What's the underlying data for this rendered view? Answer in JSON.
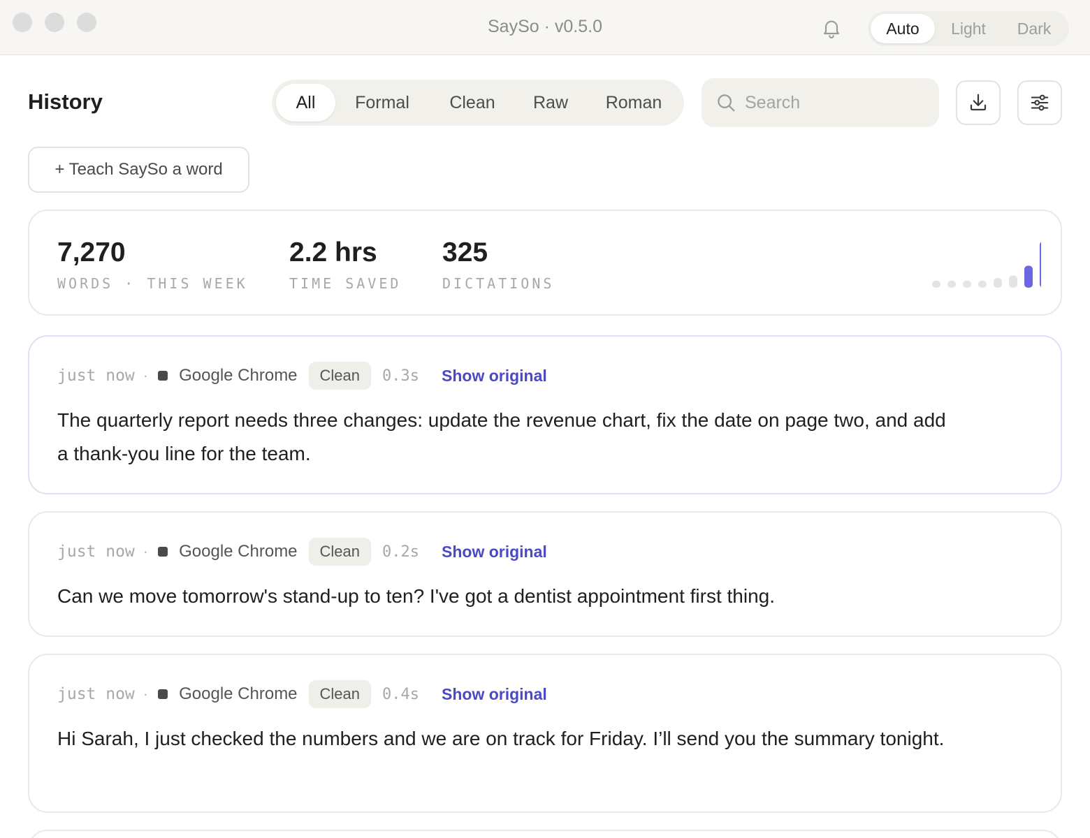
{
  "window": {
    "title": "SaySo · v0.5.0",
    "theme_options": [
      "Auto",
      "Light",
      "Dark"
    ],
    "theme_selected": "Auto"
  },
  "header": {
    "title": "History",
    "filters": [
      "All",
      "Formal",
      "Clean",
      "Raw",
      "Roman"
    ],
    "filter_selected": "All",
    "search_placeholder": "Search",
    "icons": {
      "export": "download-icon",
      "settings": "sliders-icon",
      "notifications": "bell-icon",
      "search": "search-icon"
    }
  },
  "teach_button": {
    "label": "+ Teach SaySo a word"
  },
  "stats": {
    "items": [
      {
        "value": "7,270",
        "label": "WORDS · THIS WEEK"
      },
      {
        "value": "2.2 hrs",
        "label": "TIME SAVED"
      },
      {
        "value": "325",
        "label": "DICTATIONS"
      }
    ],
    "activity_levels": [
      0,
      0,
      0,
      0,
      0.2,
      0.25,
      0.45,
      0.95
    ],
    "colors": {
      "active_bar": "#6a67e0",
      "inactive_bar": "#e4e4e4"
    }
  },
  "entries": [
    {
      "time": "just now",
      "app": "Google Chrome",
      "mode": "Clean",
      "duration": "0.3s",
      "link": "Show original",
      "text": "The quarterly report needs three changes: update the revenue chart, fix the date on page two, and add a thank-you line for the team."
    },
    {
      "time": "just now",
      "app": "Google Chrome",
      "mode": "Clean",
      "duration": "0.2s",
      "link": "Show original",
      "text": "Can we move tomorrow's stand-up to ten? I've got a dentist appointment first thing."
    },
    {
      "time": "just now",
      "app": "Google Chrome",
      "mode": "Clean",
      "duration": "0.4s",
      "link": "Show original",
      "text": "Hi Sarah, I just checked the numbers and we are on track for Friday. I’ll send you the summary tonight."
    }
  ]
}
